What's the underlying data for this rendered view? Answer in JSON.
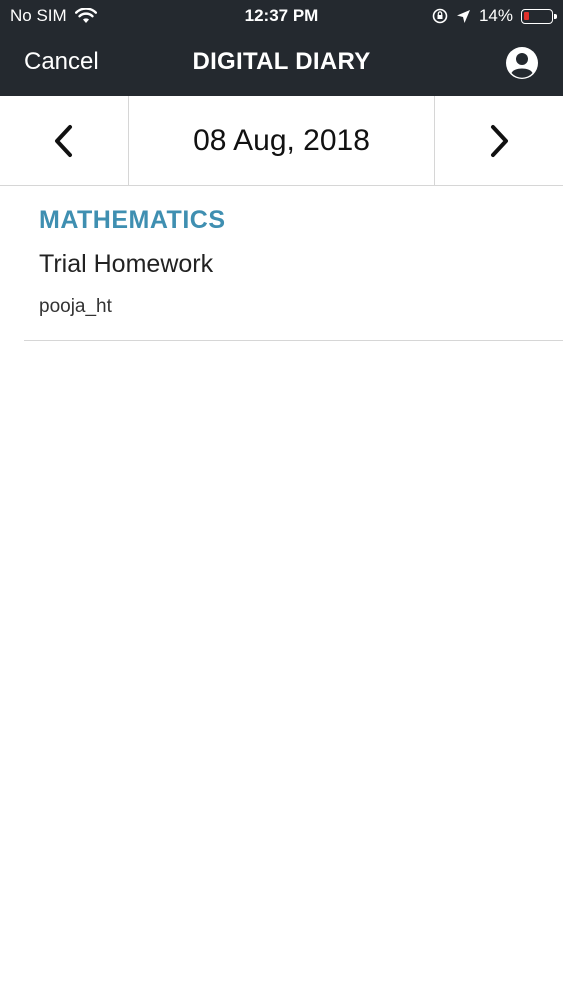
{
  "status_bar": {
    "carrier": "No SIM",
    "time": "12:37 PM",
    "battery": "14%",
    "battery_level": 0.14
  },
  "nav": {
    "cancel_label": "Cancel",
    "title": "DIGITAL DIARY",
    "profile_icon": "user-circle-icon"
  },
  "date_bar": {
    "date": "08 Aug, 2018",
    "prev_icon": "chevron-left-icon",
    "next_icon": "chevron-right-icon"
  },
  "entries": [
    {
      "subject": "MATHEMATICS",
      "title": "Trial Homework",
      "author": "pooja_ht"
    }
  ],
  "colors": {
    "header_bg": "#24292f",
    "subject_color": "#3f8fb1",
    "divider": "#d6d6d6",
    "battery_low": "#e0312b"
  }
}
